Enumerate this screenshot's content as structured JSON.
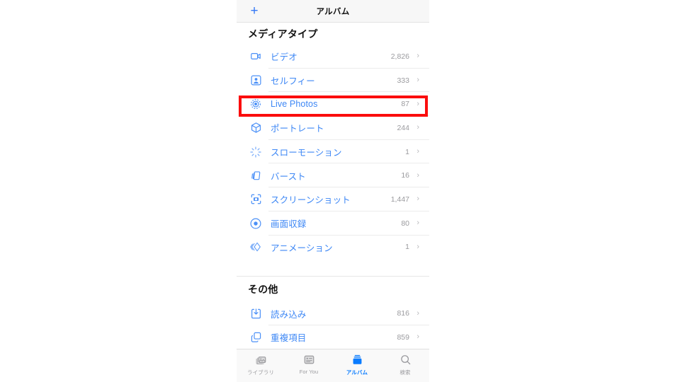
{
  "navbar": {
    "add_label": "+",
    "add_icon": "plus-icon",
    "title": "アルバム"
  },
  "sections": [
    {
      "id": "media-type",
      "header": "メディアタイプ",
      "rows": [
        {
          "icon": "video-camera-icon",
          "label": "ビデオ",
          "count": "2,826",
          "chevron": "›"
        },
        {
          "icon": "person-portrait-icon",
          "label": "セルフィー",
          "count": "333",
          "chevron": "›"
        },
        {
          "icon": "live-photos-icon",
          "label": "Live Photos",
          "count": "87",
          "chevron": "›"
        },
        {
          "icon": "cube-icon",
          "label": "ポートレート",
          "count": "244",
          "chevron": "›"
        },
        {
          "icon": "slow-motion-icon",
          "label": "スローモーション",
          "count": "1",
          "chevron": "›"
        },
        {
          "icon": "burst-stack-icon",
          "label": "バースト",
          "count": "16",
          "chevron": "›"
        },
        {
          "icon": "screenshot-icon",
          "label": "スクリーンショット",
          "count": "1,447",
          "chevron": "›"
        },
        {
          "icon": "screen-record-icon",
          "label": "画面収録",
          "count": "80",
          "chevron": "›"
        },
        {
          "icon": "animation-icon",
          "label": "アニメーション",
          "count": "1",
          "chevron": "›"
        }
      ]
    },
    {
      "id": "other",
      "header": "その他",
      "rows": [
        {
          "icon": "import-icon",
          "label": "読み込み",
          "count": "816",
          "chevron": "›"
        },
        {
          "icon": "duplicate-icon",
          "label": "重複項目",
          "count": "859",
          "chevron": "›"
        }
      ]
    }
  ],
  "tabbar": {
    "tabs": [
      {
        "icon": "photo-library-icon",
        "label": "ライブラリ",
        "active": false
      },
      {
        "icon": "for-you-card-icon",
        "label": "For You",
        "active": false
      },
      {
        "icon": "albums-icon",
        "label": "アルバム",
        "active": true
      },
      {
        "icon": "search-icon",
        "label": "検索",
        "active": false
      }
    ]
  },
  "annotation": {
    "target_row": "Live Photos",
    "box_color": "#fb0d0d"
  },
  "colors": {
    "accent_blue": "#3d87f5",
    "tab_active": "#0a7cff",
    "count_gray": "#9a9a9e",
    "highlight_red": "#fb0d0d",
    "navbar_bg": "#f7f7f7",
    "tabbar_bg": "#f9f9f9"
  }
}
